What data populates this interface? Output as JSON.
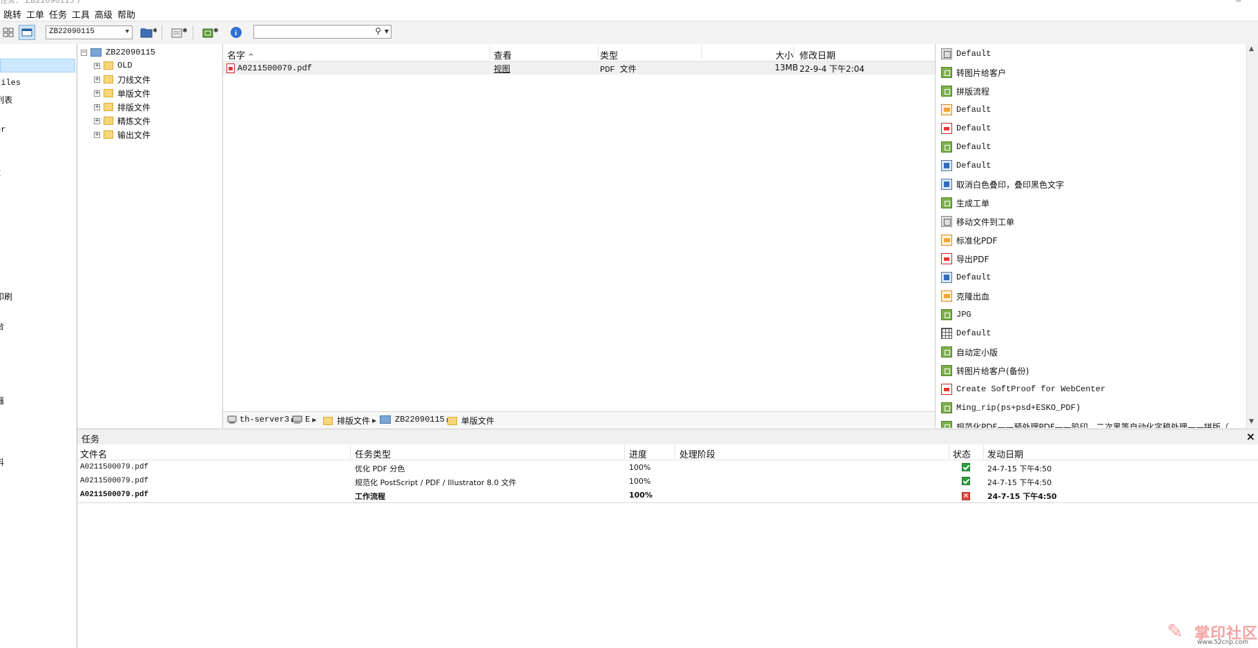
{
  "title_partial": "任务：  ZB22090115 )",
  "menu": [
    "跳转",
    "工单",
    "任务",
    "工具",
    "高级",
    "帮助"
  ],
  "toolbar": {
    "job_select": "ZB22090115",
    "search_value": ""
  },
  "left_nav": [
    {
      "label": ""
    },
    {
      "label": "Files"
    },
    {
      "label": "列表"
    },
    {
      "label": "er"
    },
    {
      "label": "E"
    },
    {
      "label": "印刷"
    },
    {
      "label": "台"
    },
    {
      "label": "器"
    },
    {
      "label": "料"
    }
  ],
  "tree": {
    "root": "ZB22090115",
    "children": [
      "OLD",
      "刀线文件",
      "单版文件",
      "排版文件",
      "精炼文件",
      "输出文件"
    ]
  },
  "files": {
    "columns": [
      "名字",
      "查看",
      "类型",
      "大小",
      "修改日期"
    ],
    "rows": [
      {
        "name": "A0211500079.pdf",
        "view": "视图",
        "type": "PDF 文件",
        "size": "13MB",
        "modified": "22-9-4 下午2:04"
      }
    ]
  },
  "path": [
    "th-server3",
    "E",
    "排版文件",
    "ZB22090115",
    "单版文件"
  ],
  "workflows": [
    {
      "label": "Default",
      "icon": "gray"
    },
    {
      "label": "转图片给客户",
      "icon": "green"
    },
    {
      "label": "拼版流程",
      "icon": "green"
    },
    {
      "label": "Default",
      "icon": "orange"
    },
    {
      "label": "Default",
      "icon": "pdf"
    },
    {
      "label": "Default",
      "icon": "green"
    },
    {
      "label": "Default",
      "icon": "blue"
    },
    {
      "label": "取消白色叠印，叠印黑色文字",
      "icon": "blue"
    },
    {
      "label": "生成工单",
      "icon": "green"
    },
    {
      "label": "移动文件到工单",
      "icon": "gray"
    },
    {
      "label": "标准化PDF",
      "icon": "orange"
    },
    {
      "label": "导出PDF",
      "icon": "pdf"
    },
    {
      "label": "Default",
      "icon": "blue"
    },
    {
      "label": "克隆出血",
      "icon": "orange"
    },
    {
      "label": "JPG",
      "icon": "green"
    },
    {
      "label": "Default",
      "icon": "grid"
    },
    {
      "label": "自动定小版",
      "icon": "green"
    },
    {
      "label": "转图片给客户(备份)",
      "icon": "green"
    },
    {
      "label": "Create SoftProof for WebCenter",
      "icon": "pdf"
    },
    {
      "label": "Ming_rip(ps+psd+ESKO_PDF)",
      "icon": "green"
    },
    {
      "label": "规范化PDF——预处理PDF——陷印、二次黑等自动化字稿处理——拼版（",
      "icon": "green"
    }
  ],
  "tasks": {
    "title": "任务",
    "columns": [
      "文件名",
      "任务类型",
      "进度",
      "处理阶段",
      "状态",
      "发动日期"
    ],
    "rows": [
      {
        "file": "A0211500079.pdf",
        "type": "优化 PDF 分色",
        "progress": "100%",
        "stage": "",
        "status": "ok",
        "date": "24-7-15 下午4:50",
        "bold": false
      },
      {
        "file": "A0211500079.pdf",
        "type": "规范化 PostScript / PDF / Illustrator 8.0 文件",
        "progress": "100%",
        "stage": "",
        "status": "ok",
        "date": "24-7-15 下午4:50",
        "bold": false
      },
      {
        "file": "A0211500079.pdf",
        "type": "工作流程",
        "progress": "100%",
        "stage": "",
        "status": "error",
        "date": "24-7-15 下午4:50",
        "bold": true
      }
    ]
  },
  "watermark": {
    "brand": "掌印社区",
    "url": "www.52cnp.com"
  }
}
